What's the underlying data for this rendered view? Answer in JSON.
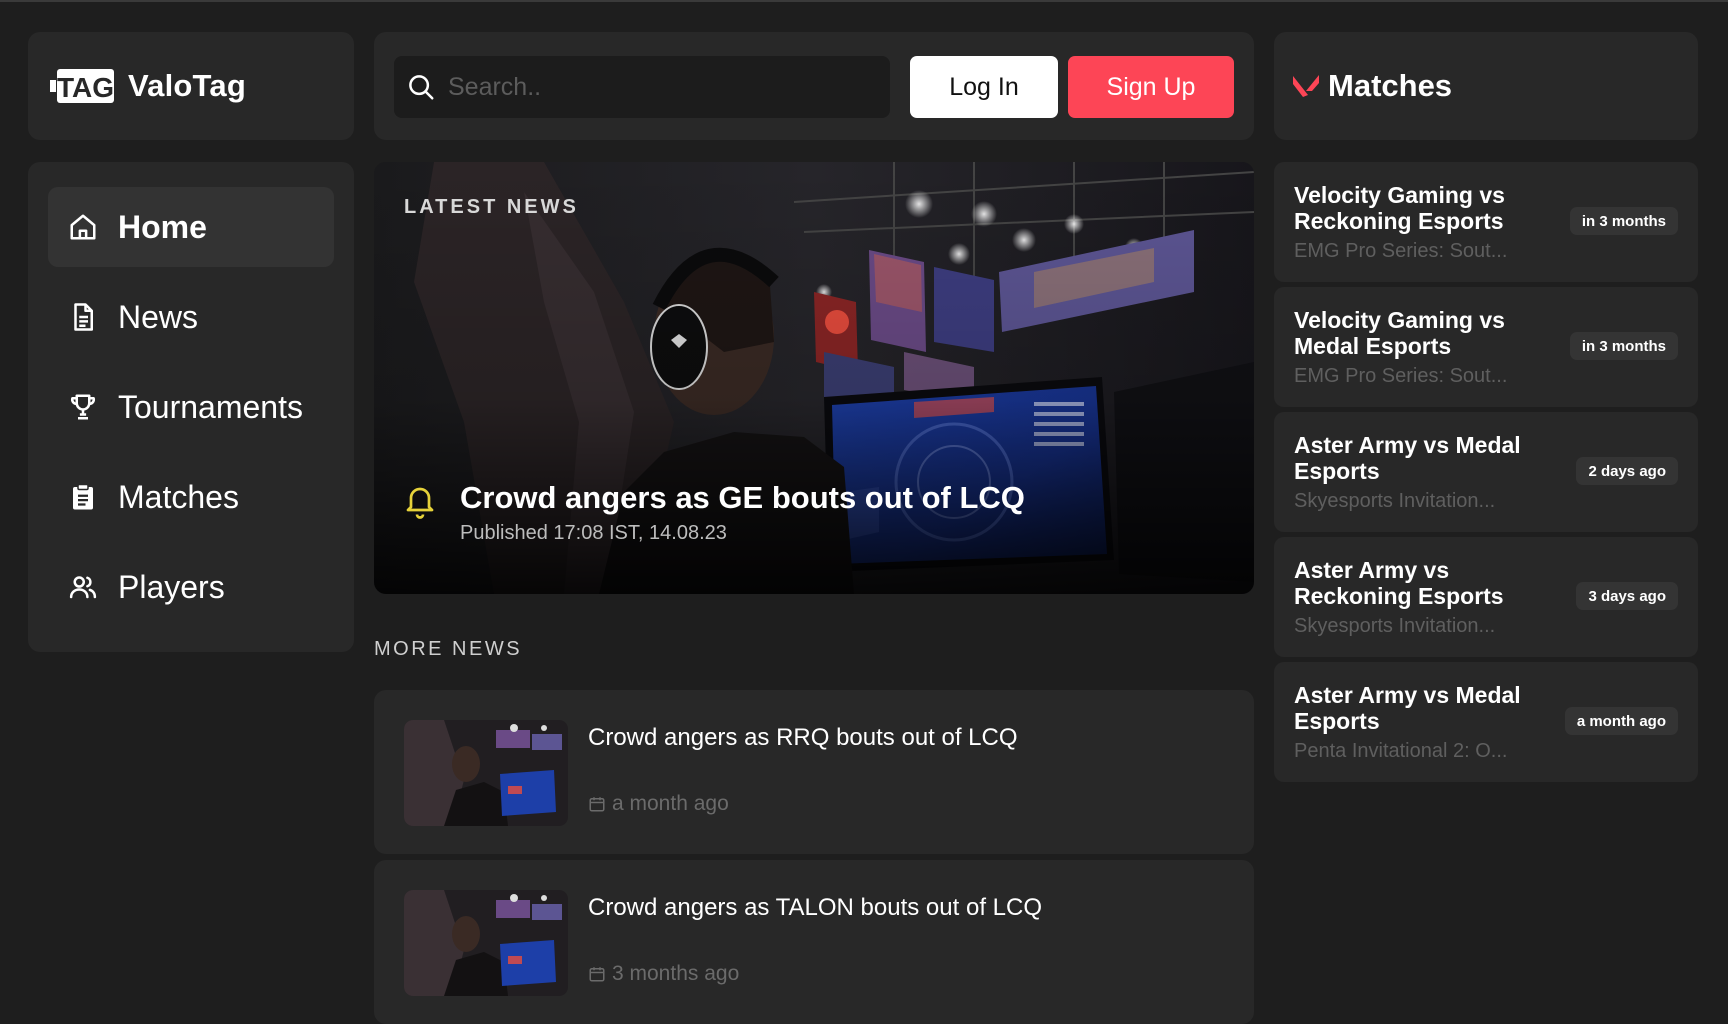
{
  "brand": {
    "logo_glyph": "TAG",
    "name": "ValoTag",
    "accent": "#fd4556"
  },
  "sidebar": {
    "items": [
      {
        "label": "Home",
        "icon": "home-icon",
        "active": true
      },
      {
        "label": "News",
        "icon": "document-icon"
      },
      {
        "label": "Tournaments",
        "icon": "trophy-icon"
      },
      {
        "label": "Matches",
        "icon": "clipboard-icon"
      },
      {
        "label": "Players",
        "icon": "users-icon"
      }
    ]
  },
  "header": {
    "search_placeholder": "Search..",
    "login_label": "Log In",
    "signup_label": "Sign Up"
  },
  "hero": {
    "kicker": "LATEST NEWS",
    "title": "Crowd angers as GE bouts out of LCQ",
    "published": "Published 17:08 IST, 14.08.23",
    "icon": "bell-icon",
    "bell_color": "#e6d23a"
  },
  "more_news": {
    "label": "MORE NEWS",
    "items": [
      {
        "title": "Crowd angers as RRQ bouts out of LCQ",
        "time": "a month ago"
      },
      {
        "title": "Crowd angers as TALON bouts out of LCQ",
        "time": "3 months ago"
      }
    ]
  },
  "matches": {
    "title": "Matches",
    "icon": "valorant-logo-icon",
    "items": [
      {
        "name": "Velocity Gaming vs Reckoning Esports",
        "event": "EMG Pro Series: Sout...",
        "when": "in 3 months"
      },
      {
        "name": "Velocity Gaming vs Medal Esports",
        "event": "EMG Pro Series: Sout...",
        "when": "in 3 months"
      },
      {
        "name": "Aster Army vs Medal Esports",
        "event": "Skyesports Invitation...",
        "when": "2 days ago"
      },
      {
        "name": "Aster Army vs Reckoning Esports",
        "event": "Skyesports Invitation...",
        "when": "3 days ago"
      },
      {
        "name": "Aster Army vs Medal Esports",
        "event": "Penta Invitational 2: O...",
        "when": "a month ago"
      }
    ]
  }
}
